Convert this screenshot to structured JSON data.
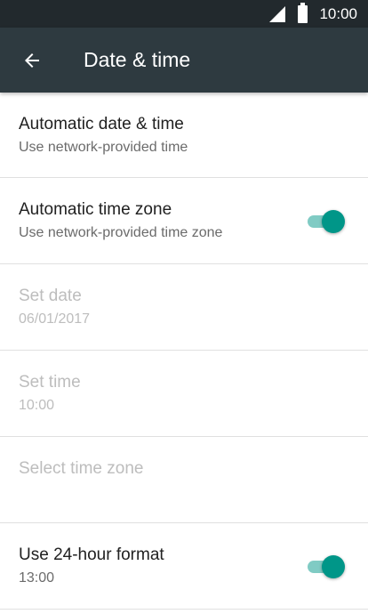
{
  "status_bar": {
    "time": "10:00"
  },
  "app_bar": {
    "title": "Date & time",
    "back_icon": "arrow-back-icon"
  },
  "settings": [
    {
      "title": "Automatic date & time",
      "summary": "Use network-provided time",
      "enabled": true,
      "toggle": false
    },
    {
      "title": "Automatic time zone",
      "summary": "Use network-provided time zone",
      "enabled": true,
      "toggle": true,
      "checked": true
    },
    {
      "title": "Set date",
      "summary": "06/01/2017",
      "enabled": false
    },
    {
      "title": "Set time",
      "summary": "10:00",
      "enabled": false
    },
    {
      "title": "Select time zone",
      "summary": "",
      "enabled": false
    },
    {
      "title": "Use 24-hour format",
      "summary": "13:00",
      "enabled": true,
      "toggle": true,
      "checked": true
    }
  ],
  "colors": {
    "accent": "#009688",
    "accent_track": "#80cbc4",
    "app_bar": "#2e3a40",
    "status_bar": "#22292d"
  }
}
